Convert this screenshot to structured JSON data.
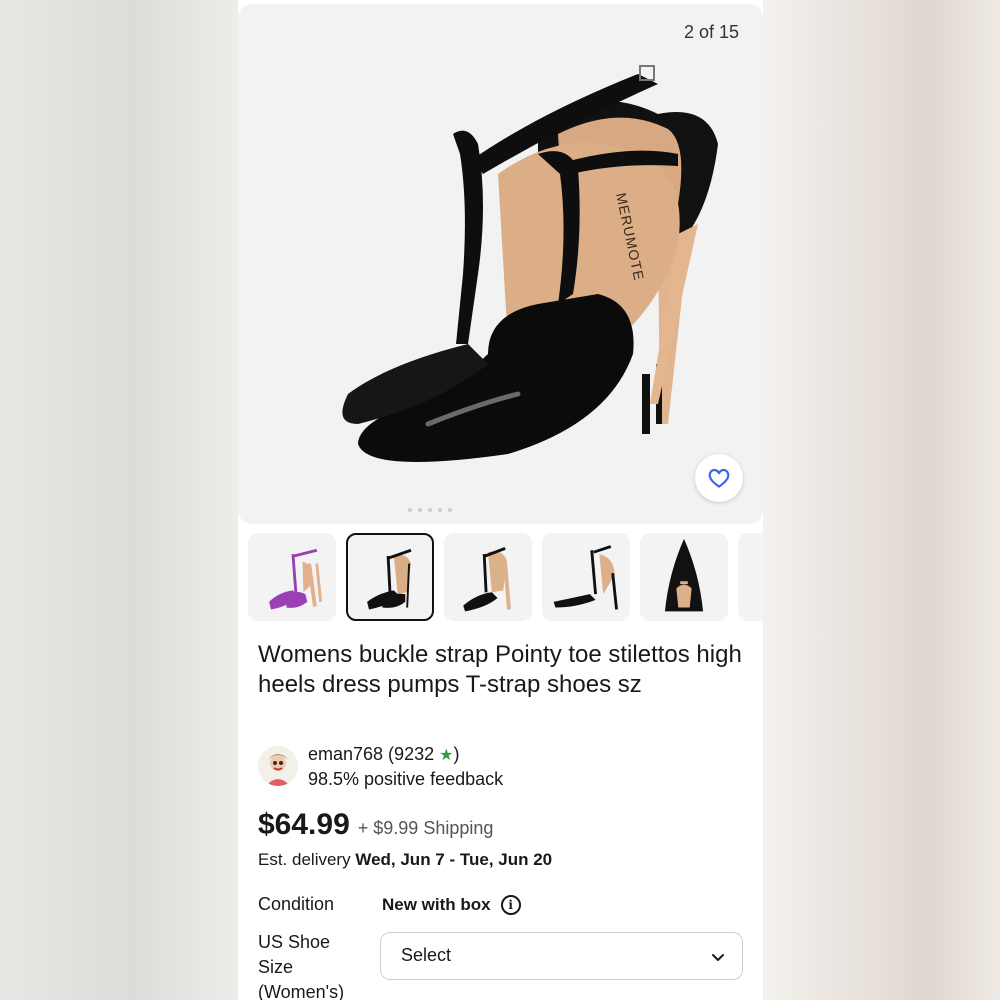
{
  "gallery": {
    "counter": "2 of 15",
    "brand_imprint": "MERUMOTE",
    "thumbnails": [
      {
        "name": "purple-heels",
        "color": "#9b3fb5"
      },
      {
        "name": "black-heels",
        "color": "#111111",
        "selected": true
      },
      {
        "name": "black-heels-nude",
        "color": "#111111"
      },
      {
        "name": "black-heels-side",
        "color": "#111111"
      },
      {
        "name": "black-heel-top",
        "color": "#111111"
      },
      {
        "name": "more",
        "color": "#111111"
      }
    ]
  },
  "listing": {
    "title": "Womens buckle strap Pointy toe stilettos high heels dress pumps T-strap shoes sz"
  },
  "seller": {
    "name_line": "eman768 (9232",
    "name_close": ")",
    "feedback": "98.5% positive feedback"
  },
  "pricing": {
    "price": "$64.99",
    "shipping": "+ $9.99 Shipping",
    "delivery_prefix": "Est. delivery",
    "delivery_range": "Wed, Jun 7 - Tue, Jun 20"
  },
  "details": {
    "condition_label": "Condition",
    "condition_value": "New with box",
    "size_label_1": "US Shoe",
    "size_label_2": "Size",
    "size_label_3": "(Women's)",
    "size_select": "Select"
  },
  "colors": {
    "accent": "#3665f3",
    "star": "#2f9e44"
  }
}
